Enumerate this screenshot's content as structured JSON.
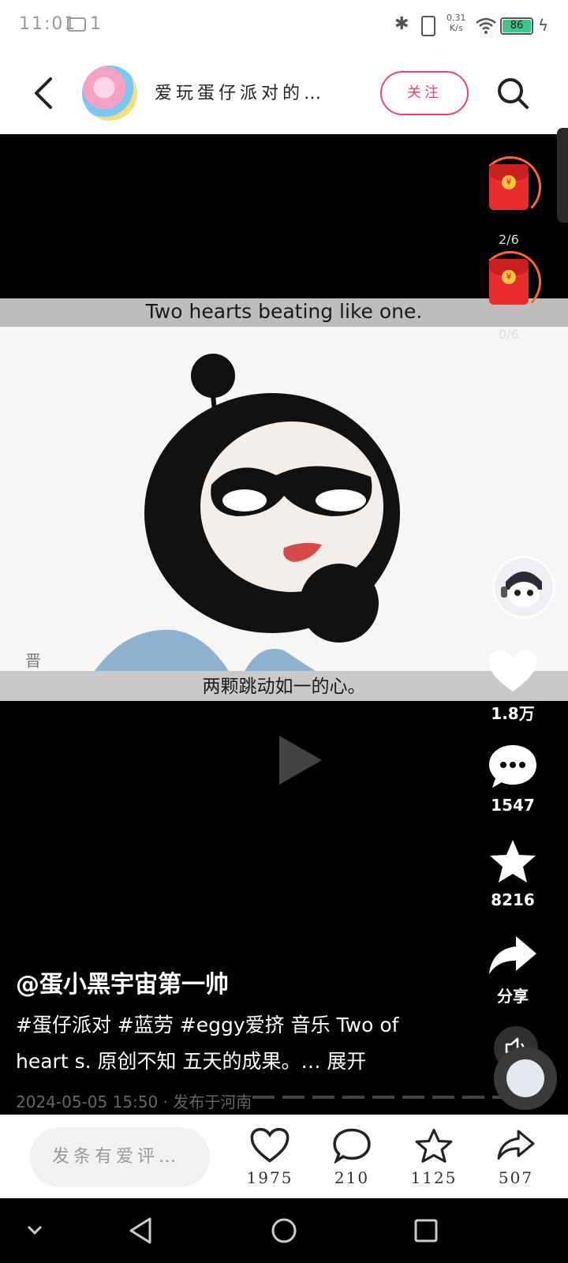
{
  "status_bar": {
    "time": "11:01",
    "notification_count": "1",
    "net_speed_value": "0.31",
    "net_speed_unit": "K/s",
    "battery": "86"
  },
  "header": {
    "author_name": "爱玩蛋仔派对的…",
    "follow_label": "关注"
  },
  "video": {
    "subtitle_en": "Two hearts beating like one.",
    "subtitle_zh": "两颗跳动如一的心。",
    "watermark_char": "晋"
  },
  "red_packets": [
    {
      "count": "2/6"
    },
    {
      "count": "0/6"
    }
  ],
  "rail": {
    "like_count": "1.8万",
    "comment_count": "1547",
    "favorite_count": "8216",
    "share_label": "分享"
  },
  "caption": {
    "username": "@蛋小黑宇宙第一帅",
    "description": "#蛋仔派对 #蓝劳 #eggy爱挤 音乐 Two of heart s. 原创不知 五天的成果。…",
    "expand_label": "展开",
    "timestamp": "2024-05-05 15:50 · 发布于河南"
  },
  "action_bar": {
    "comment_placeholder": "发条有爱评…",
    "like_count": "1975",
    "comment_count": "210",
    "favorite_count": "1125",
    "share_count": "507"
  },
  "colors": {
    "accent": "#e8476d",
    "battery": "#3bc88a",
    "red_packet": "#e82c2c"
  }
}
